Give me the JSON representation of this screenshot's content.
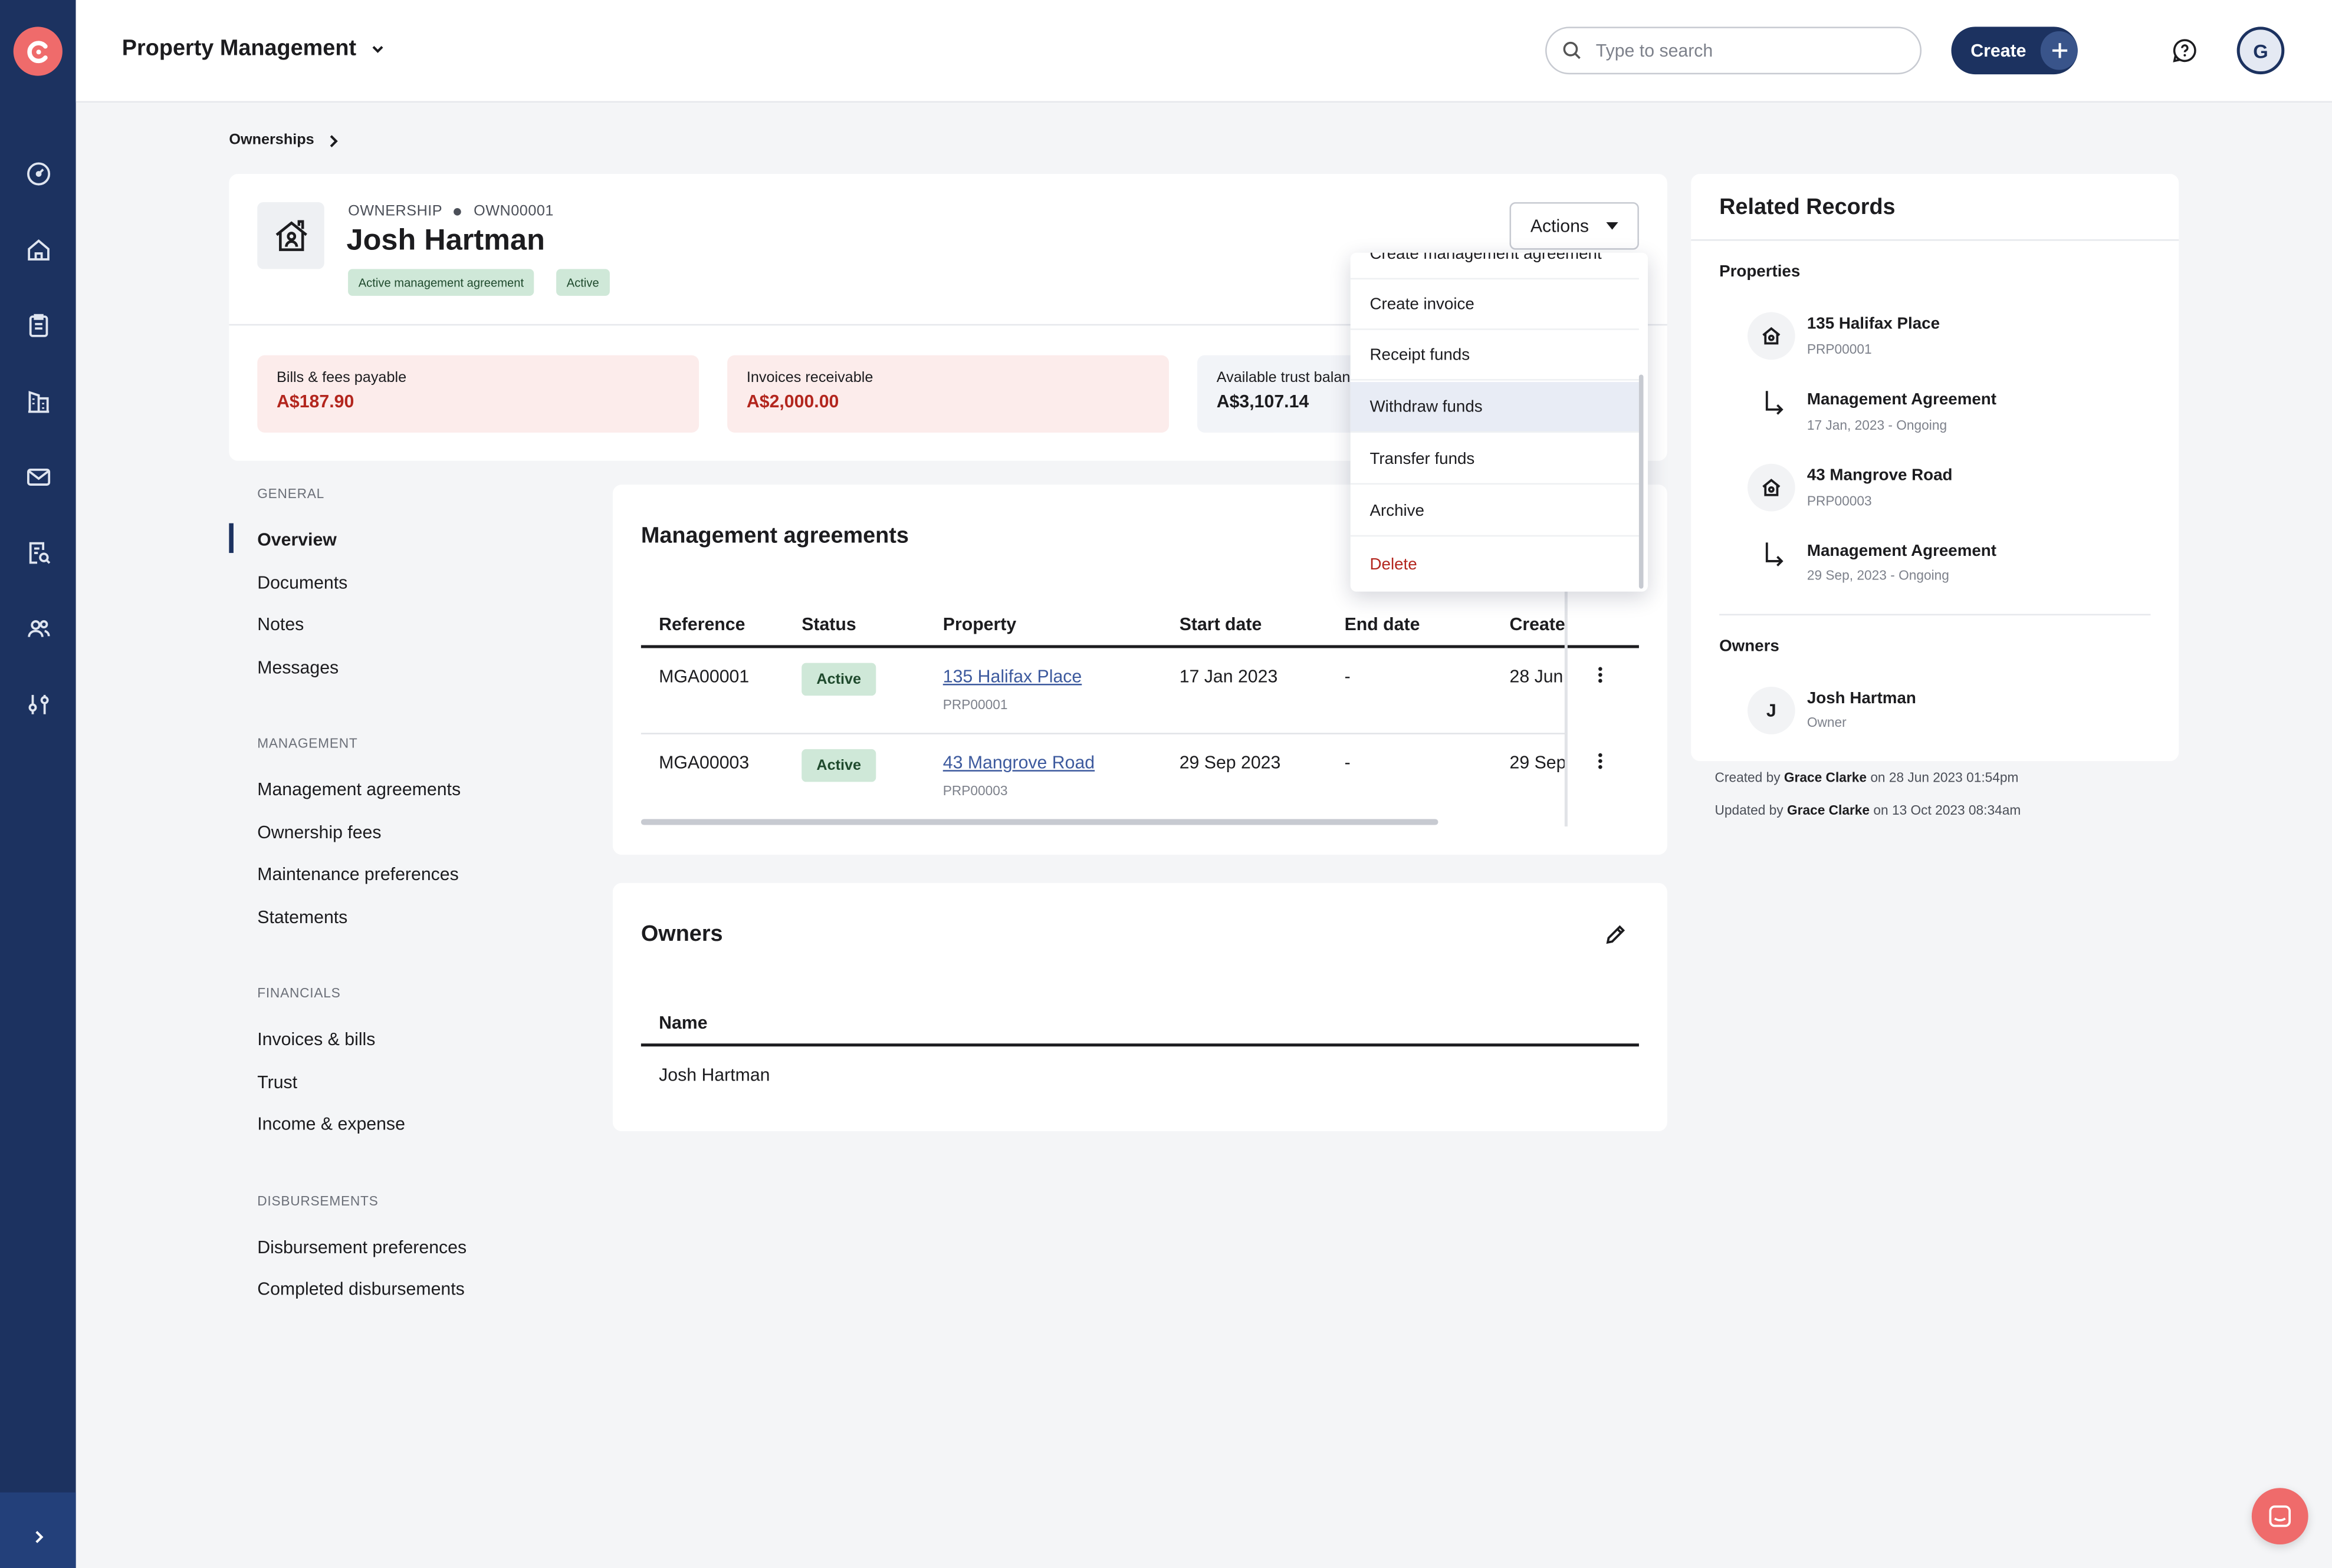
{
  "app": {
    "module": "Property Management"
  },
  "search": {
    "placeholder": "Type to search"
  },
  "header_actions": {
    "create_label": "Create",
    "avatar_initial": "G"
  },
  "breadcrumb": {
    "item": "Ownerships"
  },
  "ownership": {
    "type": "OWNERSHIP",
    "id": "OWN00001",
    "name": "Josh Hartman",
    "tags": [
      "Active management agreement",
      "Active"
    ],
    "actions_label": "Actions"
  },
  "stats": [
    {
      "label": "Bills & fees payable",
      "value": "A$187.90"
    },
    {
      "label": "Invoices receivable",
      "value": "A$2,000.00"
    },
    {
      "label": "Available trust balance",
      "value": "A$3,107.14"
    }
  ],
  "colors": {
    "rail": "#1c3260",
    "accent": "#ef6b6b",
    "payable_bg": "#fceceb",
    "amount_red": "#b3261e",
    "trust_bg": "#f2f4f8",
    "active_green": "#cfe8d8"
  },
  "nav": {
    "general": {
      "heading": "GENERAL",
      "items": [
        "Overview",
        "Documents",
        "Notes",
        "Messages"
      ]
    },
    "management": {
      "heading": "MANAGEMENT",
      "items": [
        "Management agreements",
        "Ownership fees",
        "Maintenance preferences",
        "Statements"
      ]
    },
    "financials": {
      "heading": "FINANCIALS",
      "items": [
        "Invoices & bills",
        "Trust",
        "Income & expense"
      ]
    },
    "disbursements": {
      "heading": "DISBURSEMENTS",
      "items": [
        "Disbursement preferences",
        "Completed disbursements"
      ]
    },
    "active": "Overview"
  },
  "management_agreements": {
    "title": "Management agreements",
    "columns": [
      "Reference",
      "Status",
      "Property",
      "Start date",
      "End date",
      "Created"
    ],
    "rows": [
      {
        "reference": "MGA00001",
        "status": "Active",
        "property": "135 Halifax Place",
        "property_id": "PRP00001",
        "start": "17 Jan 2023",
        "end": "-",
        "created": "28 Jun"
      },
      {
        "reference": "MGA00003",
        "status": "Active",
        "property": "43 Mangrove Road",
        "property_id": "PRP00003",
        "start": "29 Sep 2023",
        "end": "-",
        "created": "29 Sep"
      }
    ]
  },
  "owners_section": {
    "title": "Owners",
    "column": "Name",
    "rows": [
      "Josh Hartman"
    ]
  },
  "related": {
    "title": "Related Records",
    "properties_heading": "Properties",
    "items": [
      {
        "title": "135 Halifax Place",
        "sub": "PRP00001",
        "icon": "house-icon"
      },
      {
        "title": "Management Agreement",
        "sub": "17 Jan, 2023 - Ongoing",
        "icon": "arrow-turn-icon"
      },
      {
        "title": "43 Mangrove Road",
        "sub": "PRP00003",
        "icon": "house-icon"
      },
      {
        "title": "Management Agreement",
        "sub": "29 Sep, 2023 - Ongoing",
        "icon": "arrow-turn-icon"
      }
    ],
    "owners_heading": "Owners",
    "owner": {
      "initial": "J",
      "name": "Josh Hartman",
      "role": "Owner"
    }
  },
  "audit": {
    "created_prefix": "Created by",
    "created_by": "Grace Clarke",
    "created_on": "on 28 Jun 2023 01:54pm",
    "updated_prefix": "Updated by",
    "updated_by": "Grace Clarke",
    "updated_on": "on 13 Oct 2023 08:34am"
  },
  "actions_menu": {
    "items": [
      "Create management agreement",
      "Create invoice",
      "Receipt funds",
      "Withdraw funds",
      "Transfer funds",
      "Archive",
      "Delete"
    ],
    "highlighted": "Withdraw funds"
  }
}
